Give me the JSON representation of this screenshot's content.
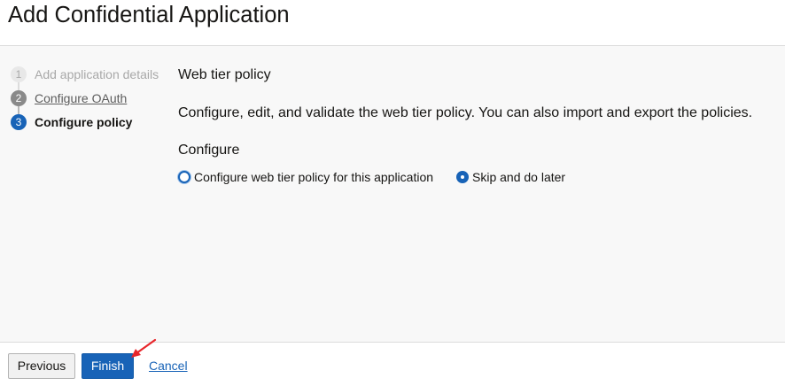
{
  "page": {
    "title": "Add Confidential Application"
  },
  "steps": [
    {
      "number": "1",
      "label": "Add application details",
      "state": "disabled"
    },
    {
      "number": "2",
      "label": "Configure OAuth",
      "state": "visited"
    },
    {
      "number": "3",
      "label": "Configure policy",
      "state": "current"
    }
  ],
  "content": {
    "section_title": "Web tier policy",
    "description": "Configure, edit, and validate the web tier policy. You can also import and export the policies.",
    "configure_label": "Configure",
    "radio_options": [
      {
        "label": "Configure web tier policy for this application",
        "selected": false
      },
      {
        "label": "Skip and do later",
        "selected": true
      }
    ]
  },
  "footer": {
    "previous_label": "Previous",
    "finish_label": "Finish",
    "cancel_label": "Cancel"
  },
  "colors": {
    "accent": "#1863b7",
    "annotation_arrow": "#e8262b"
  }
}
